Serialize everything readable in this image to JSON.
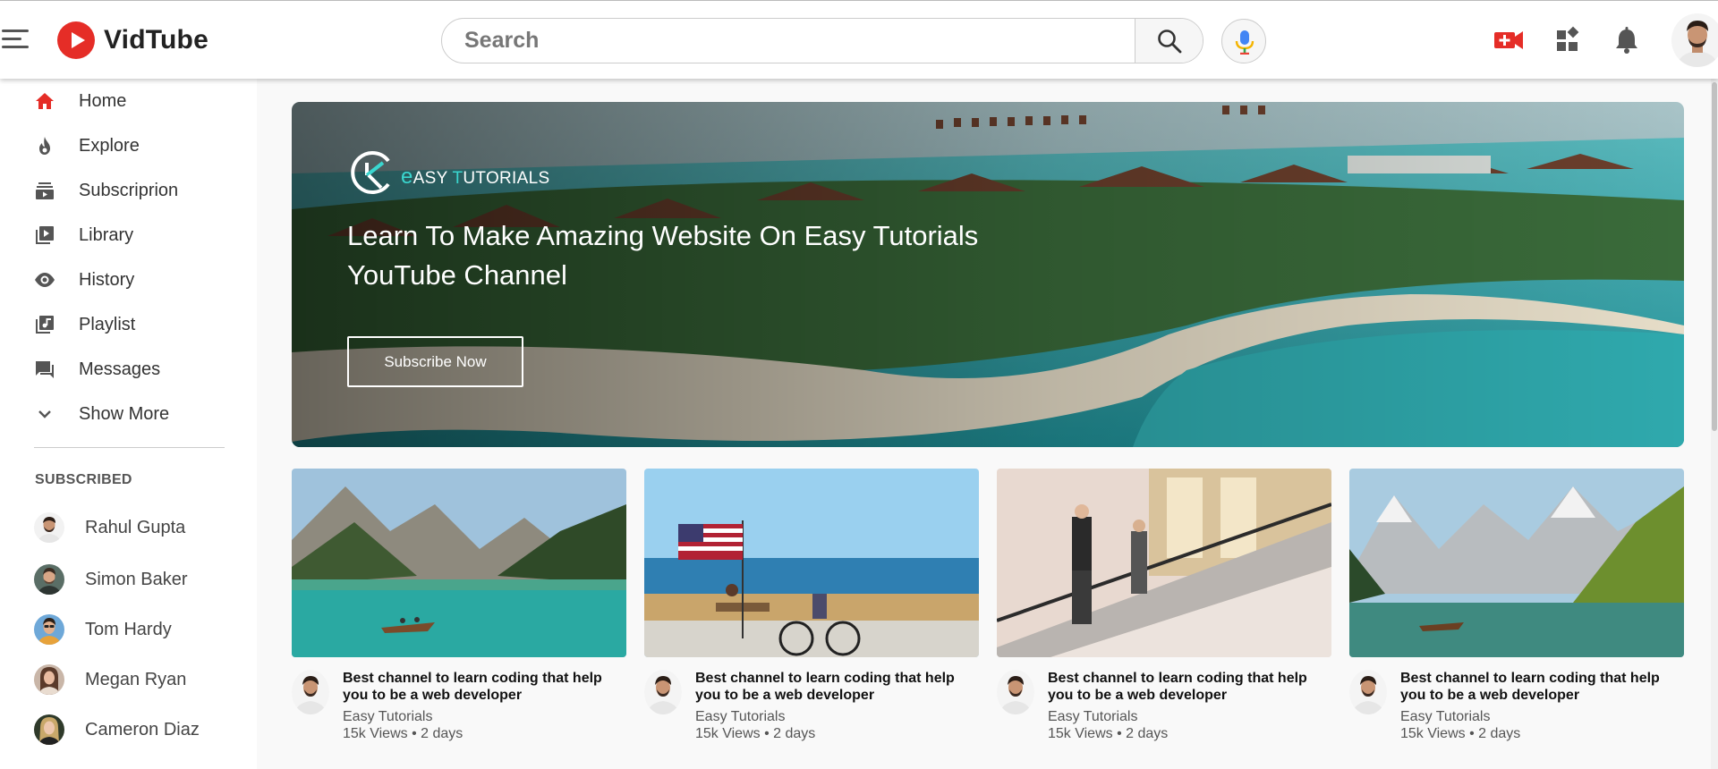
{
  "app": {
    "name": "VidTube",
    "colors": {
      "brand_red": "#e52d27",
      "accent_teal": "#3ad6cf",
      "mic_blue": "#4285f4"
    }
  },
  "header": {
    "menu_icon": "hamburger-menu-icon",
    "search": {
      "placeholder": "Search",
      "value": ""
    },
    "icons": [
      "search-icon",
      "microphone-icon",
      "video-upload-icon",
      "apps-icon",
      "bell-icon"
    ]
  },
  "sidebar": {
    "items": [
      {
        "label": "Home",
        "icon": "home-icon"
      },
      {
        "label": "Explore",
        "icon": "flame-icon"
      },
      {
        "label": "Subscriprion",
        "icon": "subscriptions-icon"
      },
      {
        "label": "Library",
        "icon": "library-icon"
      },
      {
        "label": "History",
        "icon": "eye-icon"
      },
      {
        "label": "Playlist",
        "icon": "playlist-icon"
      },
      {
        "label": "Messages",
        "icon": "chat-icon"
      },
      {
        "label": "Show More",
        "icon": "chevron-down-icon"
      }
    ],
    "subscribed_heading": "SUBSCRIBED",
    "subscriptions": [
      {
        "name": "Rahul Gupta"
      },
      {
        "name": "Simon Baker"
      },
      {
        "name": "Tom Hardy"
      },
      {
        "name": "Megan Ryan"
      },
      {
        "name": "Cameron Diaz"
      }
    ]
  },
  "banner": {
    "brand_first_letter": "e",
    "brand_rest_1": "ASY ",
    "brand_t": "T",
    "brand_rest_2": "UTORIALS",
    "title": "Learn To Make Amazing Website On Easy Tutorials YouTube Channel",
    "cta_label": "Subscribe Now"
  },
  "videos": [
    {
      "title": "Best channel to learn coding that help you to be a web developer",
      "channel": "Easy Tutorials",
      "views": "15k Views",
      "age": "2 days",
      "thumbnail": "lake-canoe"
    },
    {
      "title": "Best channel to learn coding that help you to be a web developer",
      "channel": "Easy Tutorials",
      "views": "15k Views",
      "age": "2 days",
      "thumbnail": "beach-flag"
    },
    {
      "title": "Best channel to learn coding that help you to be a web developer",
      "channel": "Easy Tutorials",
      "views": "15k Views",
      "age": "2 days",
      "thumbnail": "mall-escalator"
    },
    {
      "title": "Best channel to learn coding that help you to be a web developer",
      "channel": "Easy Tutorials",
      "views": "15k Views",
      "age": "2 days",
      "thumbnail": "mountain-lake"
    }
  ],
  "meta_separator": "•"
}
